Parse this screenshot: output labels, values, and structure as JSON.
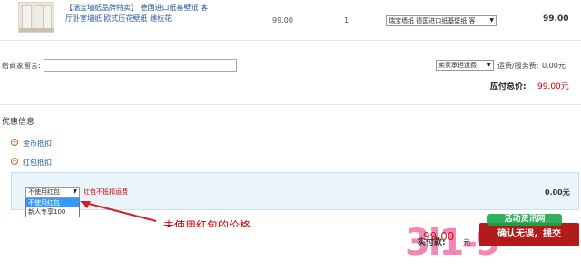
{
  "product": {
    "title": "【瑞宝墙纸品牌特卖】 德国进口纸基壁纸 客厅卧室墙纸 欧式压花壁纸 缠枝花",
    "price": "99.00",
    "qty": "1",
    "option_select": "瑞宝墙纸 德国进口纸基壁纸 客",
    "subtotal": "99.00"
  },
  "message": {
    "label": "给商家留言:",
    "value": "",
    "shipping_select": "卖家承担运费",
    "fee_label": "运费/服务费:",
    "fee_value": "0.00元",
    "total_label": "应付总价:",
    "total_value": "99.00元"
  },
  "discounts": {
    "title": "优惠信息",
    "coin_label": "金币抵扣",
    "red_label": "红包抵扣",
    "red_select": "不使用红包",
    "red_note": "红包不抵扣运费",
    "panel_amount": "0.00元",
    "options": [
      "不使用红包",
      "新人专享100"
    ]
  },
  "annotation": "未使用红包的价格",
  "footer": {
    "pay_label": "实付款:",
    "pay_value": "99.00",
    "yuan": "元",
    "confirm_button": "确认无误，提交",
    "watermark_top": "活动资讯网",
    "watermark_big": "3l1-9"
  },
  "colors": {
    "accent_red": "#b31b1b",
    "link_blue": "#2a5a9a",
    "panel_bg": "#eaf4fb"
  }
}
